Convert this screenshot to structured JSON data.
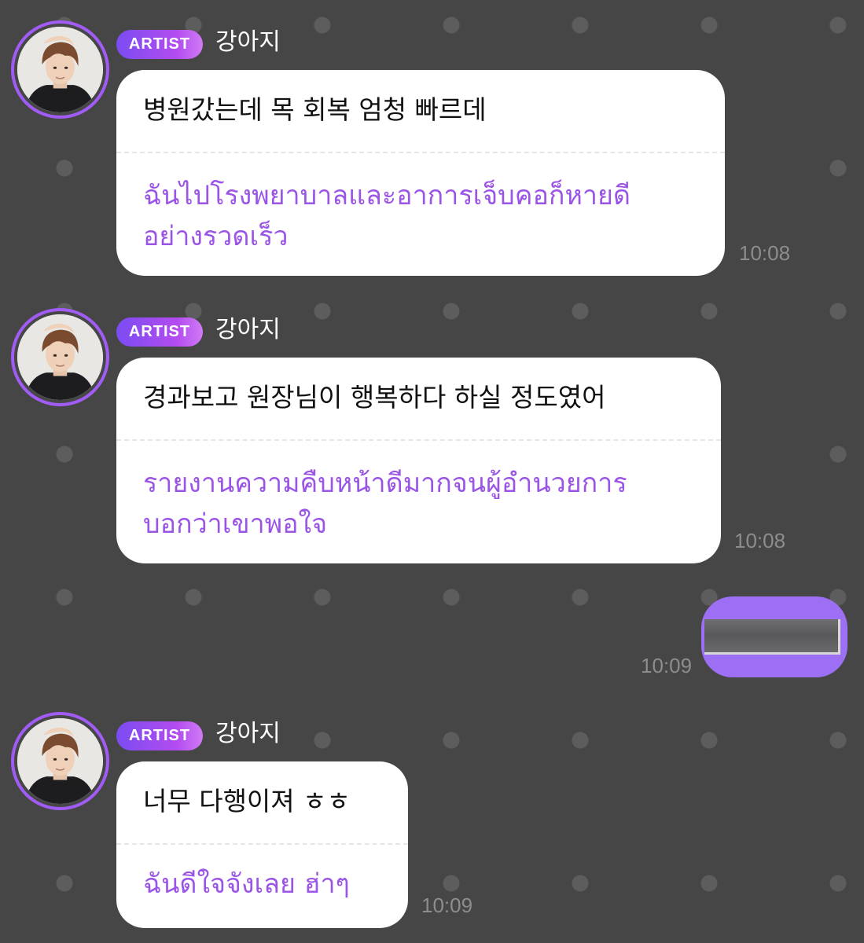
{
  "sender": {
    "badge": "ARTIST",
    "name": "강아지",
    "accent_color": "#a05cf5"
  },
  "messages": [
    {
      "original": "병원갔는데 목 회복 엄청 빠르데",
      "translation": [
        "ฉันไปโรงพยาบาลและอาการเจ็บคอก็หายดี",
        "อย่างรวดเร็ว"
      ],
      "time": "10:08"
    },
    {
      "original": "경과보고 원장님이 행복하다 하실 정도였어",
      "translation": [
        "รายงานความคืบหน้าดีมากจนผู้อำนวยการ",
        "บอกว่าเขาพอใจ"
      ],
      "time": "10:08"
    },
    {
      "original": "너무 다행이져 ㅎㅎ",
      "translation": [
        "ฉันดีใจจังเลย ฮ่าๆ"
      ],
      "time": "10:09"
    }
  ],
  "sent": {
    "time": "10:09",
    "color": "#9c6ff5"
  }
}
